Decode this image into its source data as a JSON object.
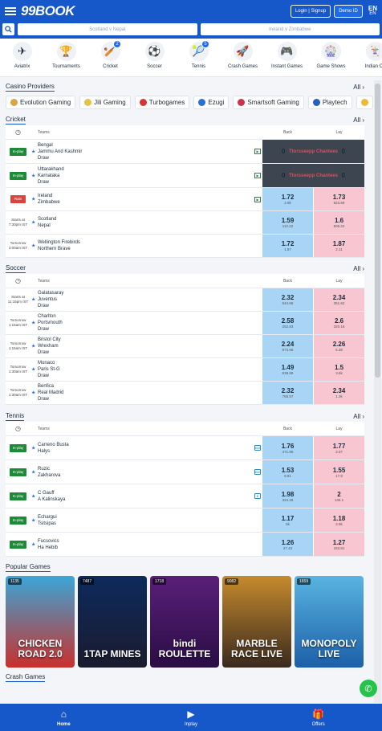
{
  "header": {
    "logo": "99BOOK",
    "login": "Login | Signup",
    "demo": "Demo ID",
    "lang_code": "EN",
    "lang_sub": "EN"
  },
  "search": {
    "left": "Scotland v Nepal",
    "right": "Ireland v Zimbabwe"
  },
  "categories": [
    {
      "label": "Aviatrix",
      "icon": "✈",
      "badge": ""
    },
    {
      "label": "Tournaments",
      "icon": "🏆",
      "badge": ""
    },
    {
      "label": "Cricket",
      "icon": "🏏",
      "badge": "2"
    },
    {
      "label": "Soccer",
      "icon": "⚽",
      "badge": ""
    },
    {
      "label": "Tennis",
      "icon": "🎾",
      "badge": "5"
    },
    {
      "label": "Crash Games",
      "icon": "🚀",
      "badge": ""
    },
    {
      "label": "Instant Games",
      "icon": "🎮",
      "badge": ""
    },
    {
      "label": "Game Shows",
      "icon": "🎡",
      "badge": ""
    },
    {
      "label": "Indian Ca",
      "icon": "🃏",
      "badge": ""
    }
  ],
  "casino": {
    "title": "Casino Providers",
    "all": "All",
    "providers": [
      {
        "name": "Evolution Gaming",
        "color": "#d9a441"
      },
      {
        "name": "Jili Gaming",
        "color": "#e6c24a"
      },
      {
        "name": "Turbogames",
        "color": "#d83434"
      },
      {
        "name": "Ezugi",
        "color": "#2a6fd6"
      },
      {
        "name": "Smartsoft Gaming",
        "color": "#c8344a"
      },
      {
        "name": "Playtech",
        "color": "#2a5fbf"
      }
    ]
  },
  "cricket": {
    "title": "Cricket",
    "all": "All",
    "h_teams": "Teams",
    "h_back": "Back",
    "h_lay": "Lay",
    "rows": [
      {
        "status": "In-play",
        "teams": [
          "Bengal",
          "Jammu And Kashmir",
          "Draw"
        ],
        "suspended": true,
        "back": "0",
        "lay": "0",
        "note": "Ttorsseepp Chantees"
      },
      {
        "status": "In-play",
        "teams": [
          "Uttarakhand",
          "Karnataka",
          "Draw"
        ],
        "suspended": true,
        "back": "0",
        "lay": "0",
        "note": "Ttorsseepp Chantees"
      },
      {
        "status": "Rain",
        "teams": [
          "Ireland",
          "Zimbabwe"
        ],
        "suspended": false,
        "back": "1.72",
        "bvol": "2.8k",
        "lay": "1.73",
        "lvol": "823.59"
      },
      {
        "status": "Starts at 7:30pm IST",
        "teams": [
          "Scotland",
          "Nepal"
        ],
        "suspended": false,
        "back": "1.59",
        "bvol": "112.22",
        "lay": "1.6",
        "lvol": "506.22"
      },
      {
        "status": "Tomorrow 3:00am IST",
        "teams": [
          "Wellington Firebirds",
          "Northern Brave"
        ],
        "suspended": false,
        "back": "1.72",
        "bvol": "1.87",
        "lay": "1.87",
        "lvol": "2.11"
      }
    ]
  },
  "soccer": {
    "title": "Soccer",
    "all": "All",
    "h_teams": "Teams",
    "h_back": "Back",
    "h_lay": "Lay",
    "rows": [
      {
        "status": "Starts at 11:15pm IST",
        "teams": [
          "Galatasaray",
          "Juventus",
          "Draw"
        ],
        "back": "2.32",
        "bvol": "544.66",
        "lay": "2.34",
        "lvol": "351.62"
      },
      {
        "status": "Tomorrow 1:15am IST",
        "teams": [
          "Charlton",
          "Portsmouth",
          "Draw"
        ],
        "back": "2.58",
        "bvol": "252.83",
        "lay": "2.6",
        "lvol": "320.16"
      },
      {
        "status": "Tomorrow 1:15am IST",
        "teams": [
          "Bristol City",
          "Wrexham",
          "Draw"
        ],
        "back": "2.24",
        "bvol": "973.66",
        "lay": "2.26",
        "lvol": "5.38"
      },
      {
        "status": "Tomorrow 1:30am IST",
        "teams": [
          "Monaco",
          "Paris St-G",
          "Draw"
        ],
        "back": "1.49",
        "bvol": "838.89",
        "lay": "1.5",
        "lvol": "3.6k"
      },
      {
        "status": "Tomorrow 1:30am IST",
        "teams": [
          "Benfica",
          "Real Madrid",
          "Draw"
        ],
        "back": "2.32",
        "bvol": "765.57",
        "lay": "2.34",
        "lvol": "1.3k"
      }
    ]
  },
  "tennis": {
    "title": "Tennis",
    "all": "All",
    "h_teams": "Teams",
    "h_back": "Back",
    "h_lay": "Lay",
    "rows": [
      {
        "status": "In-play",
        "teams": [
          "Carreno Busta",
          "Halys"
        ],
        "back": "1.76",
        "bvol": "471.95",
        "lay": "1.77",
        "lvol": "3.07"
      },
      {
        "status": "In-play",
        "teams": [
          "Ruzic",
          "Zakharova"
        ],
        "back": "1.53",
        "bvol": "9.81",
        "lay": "1.55",
        "lvol": "17.8"
      },
      {
        "status": "In-play",
        "teams": [
          "C Gauff",
          "A Kalinskaya"
        ],
        "back": "1.98",
        "bvol": "324.26",
        "lay": "2",
        "lvol": "136.1"
      },
      {
        "status": "In-play",
        "teams": [
          "Echargui",
          "Tsitsipas"
        ],
        "back": "1.17",
        "bvol": "5k",
        "lay": "1.18",
        "lvol": "2.9k"
      },
      {
        "status": "In-play",
        "teams": [
          "Fucsovics",
          "Ha Hebib"
        ],
        "back": "1.26",
        "bvol": "27.43",
        "lay": "1.27",
        "lvol": "163.81"
      }
    ]
  },
  "popular": {
    "title": "Popular Games",
    "games": [
      {
        "count": "1135",
        "title": "CHICKEN ROAD 2.0",
        "bg": "linear-gradient(#3aa6d8,#c9302c)"
      },
      {
        "count": "7487",
        "title": "1TAP MINES",
        "bg": "linear-gradient(#0d2a5c,#1b1b2e)"
      },
      {
        "count": "1718",
        "title": "bindi ROULETTE",
        "bg": "linear-gradient(#5a1f7a,#2a0d45)"
      },
      {
        "count": "9082",
        "title": "MARBLE RACE LIVE",
        "bg": "linear-gradient(#c68a2d,#3a2a1e)"
      },
      {
        "count": "1659",
        "title": "MONOPOLY LIVE",
        "bg": "linear-gradient(#58b4e0,#1c5fa8)"
      }
    ]
  },
  "crash": {
    "title": "Crash Games"
  },
  "nav": {
    "home": "Home",
    "inplay": "Inplay",
    "offers": "Offers"
  }
}
